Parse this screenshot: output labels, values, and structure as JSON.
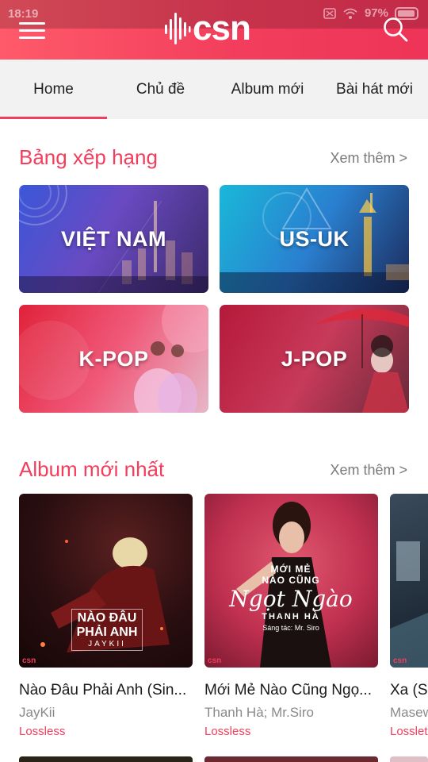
{
  "status": {
    "time": "18:19",
    "battery": "97%"
  },
  "header": {
    "logo": "csn"
  },
  "tabs": [
    {
      "label": "Home"
    },
    {
      "label": "Chủ đề"
    },
    {
      "label": "Album mới"
    },
    {
      "label": "Bài hát mới"
    }
  ],
  "charts": {
    "title": "Bảng xếp hạng",
    "see_more": "Xem thêm >",
    "items": [
      {
        "label": "VIỆT NAM"
      },
      {
        "label": "US-UK"
      },
      {
        "label": "K-POP"
      },
      {
        "label": "J-POP"
      }
    ]
  },
  "albums": {
    "title": "Album mới nhất",
    "see_more": "Xem thêm >",
    "items": [
      {
        "title": "Nào Đâu Phải Anh (Sin...",
        "artist": "JayKii",
        "quality": "Lossless",
        "cover_text": [
          "NÀO ĐÂU",
          "PHẢI ANH",
          "JAYKII"
        ]
      },
      {
        "title": "Mới Mẻ Nào Cũng Ngọ...",
        "artist": "Thanh Hà; Mr.Siro",
        "quality": "Lossless",
        "cover_text": [
          "MỚI MẺ",
          "NÀO CŨNG",
          "Ngọt Ngào",
          "THANH HÀ",
          "Sáng tác: Mr. Siro"
        ]
      },
      {
        "title": "Xa (S",
        "artist": "Masew",
        "quality": "Losslet"
      }
    ],
    "cover_mark": "csn"
  },
  "colors": {
    "accent": "#f23e5c",
    "tab_bg": "#f2f2f2"
  }
}
